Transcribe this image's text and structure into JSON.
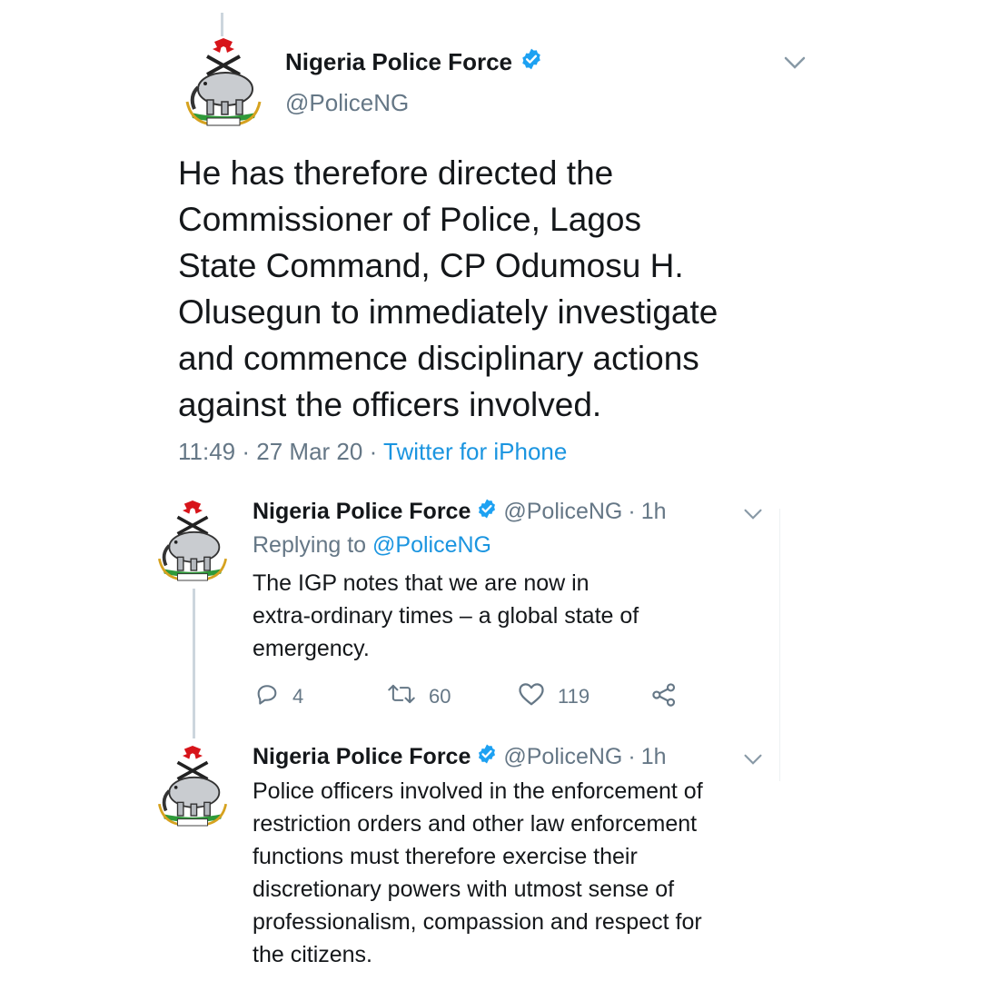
{
  "main_tweet": {
    "display_name": "Nigeria Police Force",
    "handle": "@PoliceNG",
    "text": "He has therefore directed the\nCommissioner of Police, Lagos\nState Command, CP Odumosu H.\nOlusegun to immediately investigate\nand commence disciplinary actions\nagainst the officers involved.",
    "time": "11:49",
    "date": "27 Mar 20",
    "source": "Twitter for iPhone",
    "separator": "·"
  },
  "reply_1": {
    "display_name": "Nigeria Police Force",
    "handle": "@PoliceNG",
    "age": "1h",
    "separator": "·",
    "replying_label": "Replying to",
    "replying_handle": "@PoliceNG",
    "text": "The IGP notes that we are now in\nextra-ordinary times – a global state of\nemergency.",
    "replies_count": "4",
    "retweets_count": "60",
    "likes_count": "119"
  },
  "reply_2": {
    "display_name": "Nigeria Police Force",
    "handle": "@PoliceNG",
    "age": "1h",
    "separator": "·",
    "text": "Police officers involved in the enforcement of\nrestriction orders and other law enforcement\nfunctions must therefore exercise their\ndiscretionary powers with utmost sense of\nprofessionalism, compassion and respect for\nthe citizens."
  },
  "colors": {
    "accent": "#1b95e0",
    "verified": "#1da1f2",
    "muted": "#657786",
    "text": "#14171a",
    "thread_line": "#ccd6dd"
  },
  "icons": {
    "verified": "verified-badge-icon",
    "chevron": "chevron-down-icon",
    "reply": "reply-icon",
    "retweet": "retweet-icon",
    "like": "heart-icon",
    "share": "share-icon"
  }
}
